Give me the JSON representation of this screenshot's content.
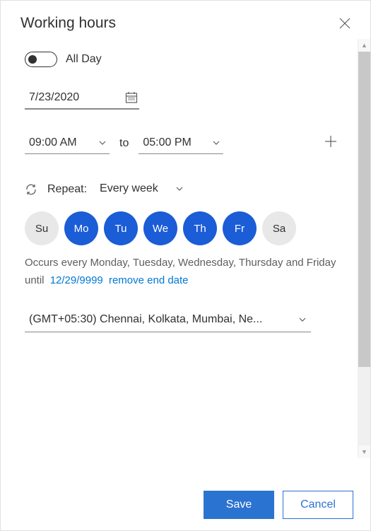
{
  "header": {
    "title": "Working hours"
  },
  "allDay": {
    "label": "All Day",
    "value": false
  },
  "date": {
    "value": "7/23/2020"
  },
  "time": {
    "start": "09:00 AM",
    "to": "to",
    "end": "05:00 PM"
  },
  "repeat": {
    "label": "Repeat:",
    "value": "Every week"
  },
  "days": [
    {
      "abbrev": "Su",
      "active": false
    },
    {
      "abbrev": "Mo",
      "active": true
    },
    {
      "abbrev": "Tu",
      "active": true
    },
    {
      "abbrev": "We",
      "active": true
    },
    {
      "abbrev": "Th",
      "active": true
    },
    {
      "abbrev": "Fr",
      "active": true
    },
    {
      "abbrev": "Sa",
      "active": false
    }
  ],
  "recurrenceSummary": "Occurs every Monday, Tuesday, Wednesday, Thursday and Friday",
  "until": {
    "prefix": "until",
    "date": "12/29/9999",
    "removeLabel": "remove end date"
  },
  "timezone": {
    "value": "(GMT+05:30) Chennai, Kolkata, Mumbai, Ne..."
  },
  "footer": {
    "save": "Save",
    "cancel": "Cancel"
  }
}
